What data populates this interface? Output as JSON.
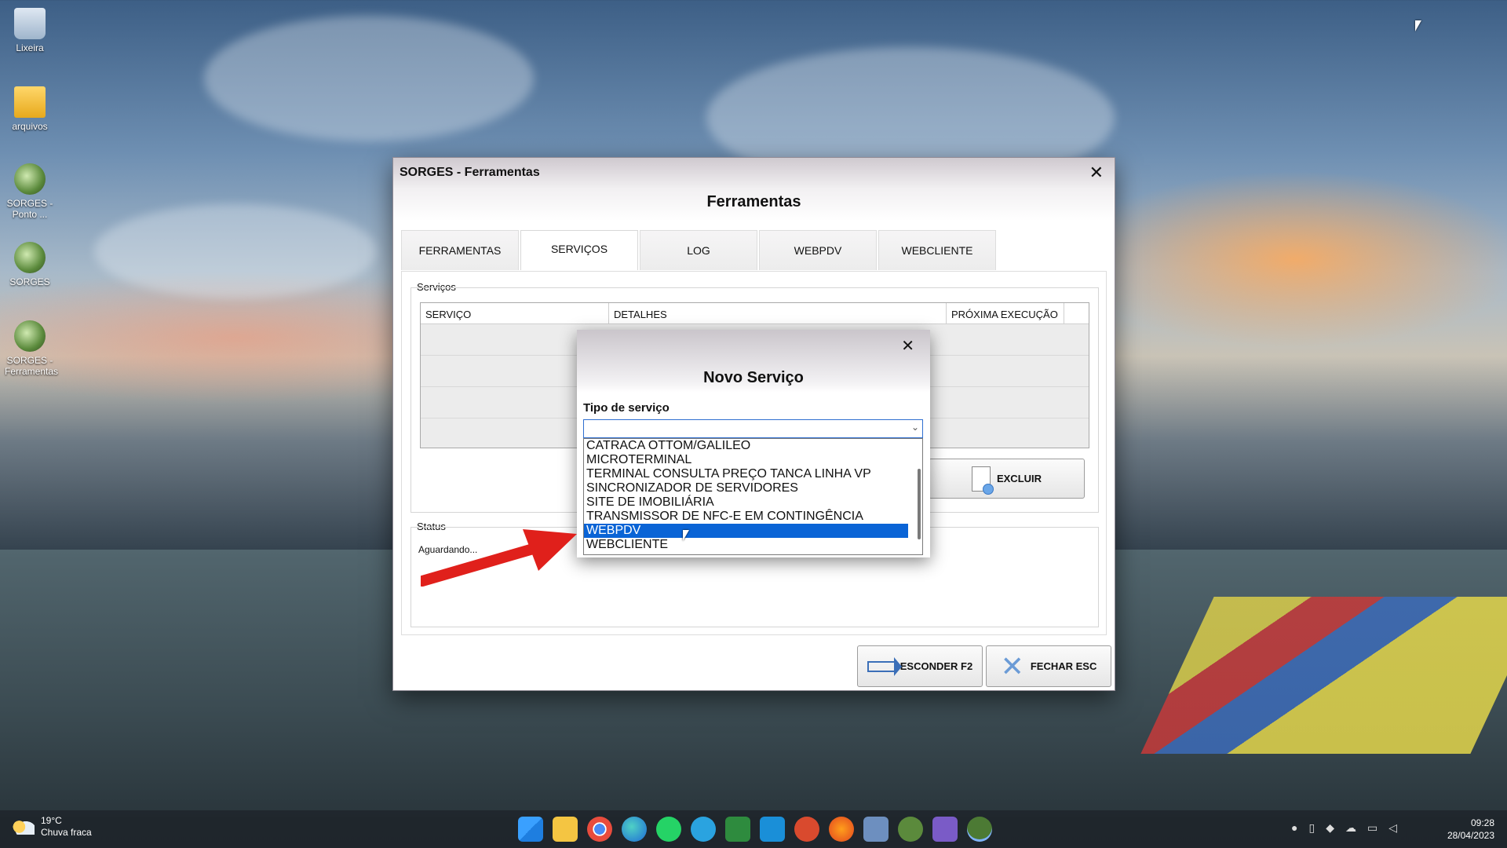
{
  "desktop": {
    "icons": [
      {
        "label": "Lixeira",
        "icon": "recycle-bin-icon"
      },
      {
        "label": "arquivos",
        "icon": "folder-icon"
      },
      {
        "label": "SORGES - Ponto ...",
        "icon": "sorges-shortcut-icon"
      },
      {
        "label": "SORGES",
        "icon": "sorges-shortcut-icon"
      },
      {
        "label": "SORGES - Ferramentas",
        "icon": "sorges-shortcut-icon"
      }
    ]
  },
  "window": {
    "title": "SORGES - Ferramentas",
    "header": "Ferramentas",
    "close": "✕",
    "tabs": [
      {
        "label": "FERRAMENTAS",
        "active": false
      },
      {
        "label": "SERVIÇOS",
        "active": true
      },
      {
        "label": "LOG",
        "active": false
      },
      {
        "label": "WEBPDV",
        "active": false
      },
      {
        "label": "WEBCLIENTE",
        "active": false
      }
    ],
    "services_group_label": "Serviços",
    "grid_columns": [
      "SERVIÇO",
      "DETALHES",
      "PRÓXIMA EXECUÇÃO"
    ],
    "excluir_label": "EXCLUIR",
    "status_group_label": "Status",
    "status_text": "Aguardando...",
    "esconder_label": "ESCONDER F2",
    "fechar_label": "FECHAR ESC"
  },
  "dialog": {
    "title": "Novo Serviço",
    "close": "✕",
    "field_label": "Tipo de serviço",
    "combo_value": "",
    "options": [
      "CATRACA OTTOM/GALILEO",
      "MICROTERMINAL",
      "TERMINAL CONSULTA PREÇO TANCA LINHA VP",
      "SINCRONIZADOR DE SERVIDORES",
      "SITE DE IMOBILIÁRIA",
      "TRANSMISSOR DE NFC-E EM CONTINGÊNCIA",
      "WEBPDV",
      "WEBCLIENTE"
    ],
    "selected_option": "WEBPDV"
  },
  "taskbar": {
    "weather_temp": "19°C",
    "weather_desc": "Chuva fraca",
    "time": "09:28",
    "date": "28/04/2023",
    "apps": [
      "start-icon",
      "file-explorer-icon",
      "chrome-icon",
      "edge-icon",
      "whatsapp-icon",
      "telegram-icon",
      "sheet-icon",
      "mail-icon",
      "app-icon",
      "firefox-icon",
      "settings-icon",
      "sorges-icon",
      "media-icon",
      "sorges-active-icon"
    ]
  },
  "colors": {
    "selection": "#0a64d6",
    "annotation_arrow": "#e0201b"
  }
}
